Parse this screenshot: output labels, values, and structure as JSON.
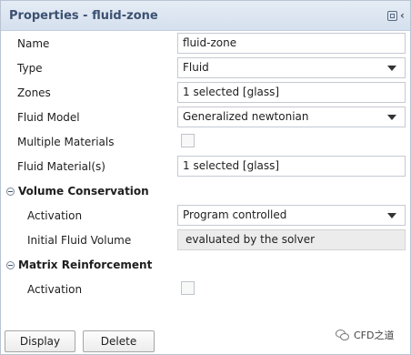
{
  "panel": {
    "title": "Properties - fluid-zone"
  },
  "rows": {
    "name": {
      "label": "Name",
      "value": "fluid-zone"
    },
    "type": {
      "label": "Type",
      "value": "Fluid"
    },
    "zones": {
      "label": "Zones",
      "value": "1 selected [glass]"
    },
    "fluid_model": {
      "label": "Fluid Model",
      "value": "Generalized newtonian"
    },
    "multiple_materials": {
      "label": "Multiple Materials",
      "checked": false
    },
    "fluid_materials": {
      "label": "Fluid Material(s)",
      "value": "1 selected [glass]"
    }
  },
  "volume_conservation": {
    "header": "Volume Conservation",
    "activation": {
      "label": "Activation",
      "value": "Program controlled"
    },
    "initial_fluid_volume": {
      "label": "Initial Fluid Volume",
      "value": "evaluated by the solver"
    }
  },
  "matrix_reinforcement": {
    "header": "Matrix Reinforcement",
    "activation": {
      "label": "Activation",
      "checked": false
    }
  },
  "buttons": {
    "display": "Display",
    "delete": "Delete"
  },
  "watermark": {
    "text": "CFD之道"
  }
}
